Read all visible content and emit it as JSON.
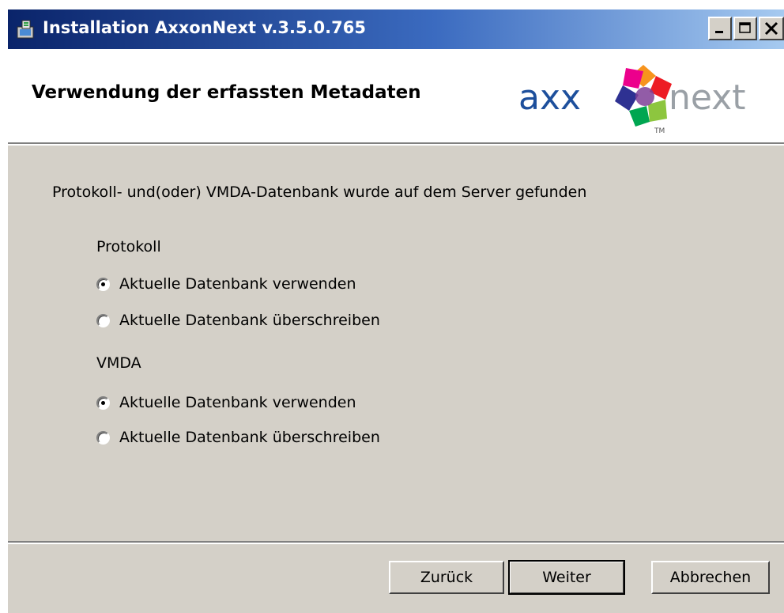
{
  "window": {
    "title": "Installation AxxonNext v.3.5.0.765",
    "controls": [
      "minimize-icon",
      "maximize-icon",
      "close-icon"
    ]
  },
  "header": {
    "title": "Verwendung der erfassten Metadaten",
    "logo": {
      "left_text": "axx",
      "right_text": "next",
      "tm": "TM"
    }
  },
  "main": {
    "intro": "Protokoll- und(oder) VMDA-Datenbank wurde auf dem Server gefunden",
    "groups": [
      {
        "label": "Protokoll",
        "options": [
          {
            "label": "Aktuelle Datenbank verwenden",
            "selected": true
          },
          {
            "label": "Aktuelle Datenbank überschreiben",
            "selected": false
          }
        ]
      },
      {
        "label": "VMDA",
        "options": [
          {
            "label": "Aktuelle Datenbank verwenden",
            "selected": true
          },
          {
            "label": "Aktuelle Datenbank überschreiben",
            "selected": false
          }
        ]
      }
    ]
  },
  "footer": {
    "back_label": "Zurück",
    "next_label": "Weiter",
    "cancel_label": "Abbrechen"
  },
  "colors": {
    "dialog_bg": "#d4d0c8",
    "titlebar_start": "#0a246a",
    "titlebar_end": "#a6caf0",
    "logo_text": "#1d4f9c"
  }
}
